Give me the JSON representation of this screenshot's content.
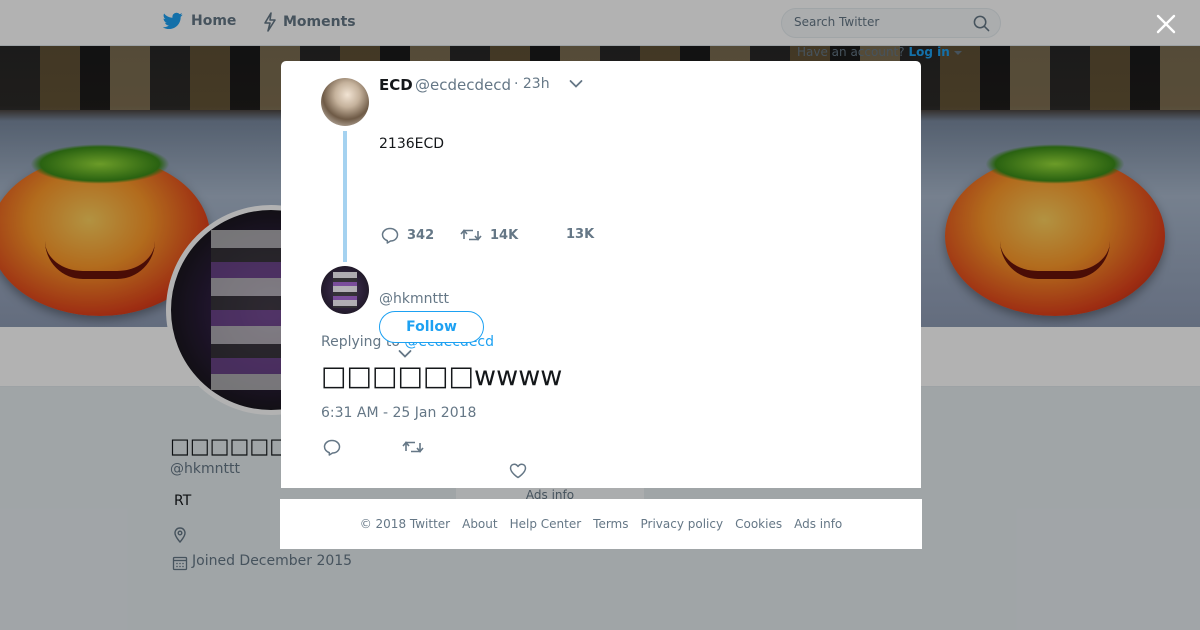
{
  "topnav": {
    "home_label": "Home",
    "moments_label": "Moments",
    "search_placeholder": "Search Twitter",
    "have_account_text": "Have an account?",
    "login_label": "Log in"
  },
  "profile": {
    "name": "□□□□□□□ □□",
    "handle": "@hkmnttt",
    "bio": "RT",
    "joined": "Joined December 2015"
  },
  "modal": {
    "tweet": {
      "name": "ECD",
      "handle": "@ecdecdecd",
      "time": "· 23h",
      "text": "2136ECD",
      "replies": "342",
      "retweets": "14K",
      "likes": "13K"
    },
    "reply": {
      "handle": "@hkmnttt",
      "follow_label": "Follow",
      "replying_prefix": "Replying to",
      "replying_handle": "@ecdecdecd",
      "text": "□□□□□□wwww",
      "date": "6:31 AM - 25 Jan 2018"
    }
  },
  "footer": {
    "items": [
      "© 2018 Twitter",
      "About",
      "Help Center",
      "Terms",
      "Privacy policy",
      "Cookies",
      "Ads info"
    ]
  },
  "background": {
    "ads_info": "Ads info"
  },
  "colors": {
    "brand": "#1da1f2",
    "muted": "#657786",
    "thread_line": "#a5d2f0"
  },
  "icons": [
    "twitter-bird-icon",
    "lightning-icon",
    "search-icon",
    "caret-down-icon",
    "close-icon",
    "reply-icon",
    "retweet-icon",
    "heart-icon",
    "location-icon",
    "calendar-icon"
  ]
}
